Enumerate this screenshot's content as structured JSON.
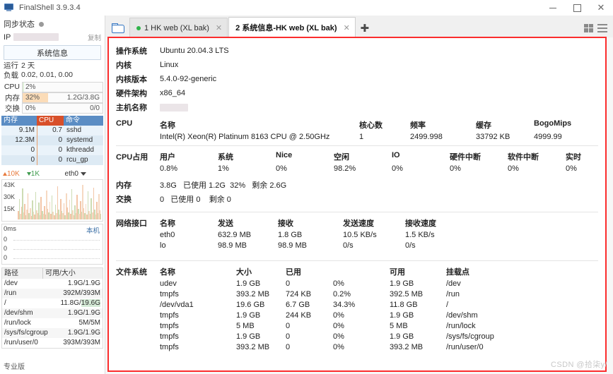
{
  "window": {
    "title": "FinalShell 3.9.3.4",
    "minimize": "—",
    "maximize": "□",
    "close": "✕"
  },
  "sidebar": {
    "sync_label": "同步状态",
    "ip_label": "IP",
    "copy_label": "复制",
    "sysinfo_button": "系统信息",
    "uptime_label": "运行",
    "uptime_value": "2 天",
    "load_label": "负载",
    "load_value": "0.02, 0.01, 0.00",
    "meters": [
      {
        "label": "CPU",
        "pct_text": "2%",
        "pct": 2,
        "right": "",
        "color": "#dff0d8"
      },
      {
        "label": "内存",
        "pct_text": "32%",
        "pct": 32,
        "right": "1.2G/3.8G",
        "color": "#fbdcb8"
      },
      {
        "label": "交换",
        "pct_text": "0%",
        "pct": 0,
        "right": "0/0",
        "color": "#e9e9e9"
      }
    ],
    "process_table": {
      "headers": [
        "内存",
        "CPU",
        "命令"
      ],
      "rows": [
        {
          "mem": "9.1M",
          "cpu": "0.7",
          "cmd": "sshd"
        },
        {
          "mem": "12.3M",
          "cpu": "0",
          "cmd": "systemd"
        },
        {
          "mem": "0",
          "cpu": "0",
          "cmd": "kthreadd"
        },
        {
          "mem": "0",
          "cpu": "0",
          "cmd": "rcu_gp"
        }
      ]
    },
    "network": {
      "up_value": "10K",
      "down_value": "1K",
      "interface": "eth0",
      "y_labels": [
        "43K",
        "30K",
        "15K"
      ]
    },
    "latency": {
      "unit_label": "0ms",
      "host_label": "本机",
      "rows": [
        "0",
        "0",
        "0"
      ]
    },
    "disk_table": {
      "headers": [
        "路径",
        "可用/大小"
      ],
      "rows": [
        {
          "path": "/dev",
          "value": "1.9G/1.9G",
          "hl": ""
        },
        {
          "path": "/run",
          "value": "392M/393M",
          "hl": ""
        },
        {
          "path": "/",
          "value": "11.8G/",
          "hl": "19.6G"
        },
        {
          "path": "/dev/shm",
          "value": "1.9G/1.9G",
          "hl": ""
        },
        {
          "path": "/run/lock",
          "value": "5M/5M",
          "hl": ""
        },
        {
          "path": "/sys/fs/cgroup",
          "value": "1.9G/1.9G",
          "hl": ""
        },
        {
          "path": "/run/user/0",
          "value": "393M/393M",
          "hl": ""
        }
      ]
    },
    "edition": "专业版"
  },
  "tabs": {
    "folder_icon": "open-folder-icon",
    "items": [
      {
        "label": "1 HK web  (XL bak)",
        "active": false,
        "dot": true
      },
      {
        "label": "2 系统信息-HK web  (XL bak)",
        "active": true,
        "dot": false
      }
    ],
    "close_glyph": "✕",
    "new_tab_glyph": "✚",
    "view_grid": "grid-view-icon",
    "view_list": "list-view-icon"
  },
  "sysinfo": {
    "basic": [
      {
        "key": "操作系统",
        "value": "Ubuntu 20.04.3 LTS",
        "masked": false
      },
      {
        "key": "内核",
        "value": "Linux",
        "masked": false
      },
      {
        "key": "内核版本",
        "value": "5.4.0-92-generic",
        "masked": false
      },
      {
        "key": "硬件架构",
        "value": "x86_64",
        "masked": false
      },
      {
        "key": "主机名称",
        "value": "",
        "masked": true
      }
    ],
    "cpu": {
      "lead": "CPU",
      "headers": [
        "名称",
        "核心数",
        "频率",
        "缓存",
        "BogoMips",
        ""
      ],
      "values": [
        "Intel(R) Xeon(R) Platinum 8163 CPU @ 2.50GHz",
        "1",
        "2499.998",
        "33792 KB",
        "4999.99",
        ""
      ]
    },
    "cpu_usage": {
      "lead": "CPU占用",
      "headers": [
        "用户",
        "系统",
        "Nice",
        "空闲",
        "IO",
        "硬件中断",
        "软件中断",
        "实时"
      ],
      "values": [
        "0.8%",
        "1%",
        "0%",
        "98.2%",
        "0%",
        "0%",
        "0%",
        "0%"
      ]
    },
    "memory": {
      "lead": "内存",
      "total": "3.8G",
      "used_label": "已使用",
      "used": "1.2G",
      "percent": "32%",
      "free_label": "剩余",
      "free": "2.6G"
    },
    "swap": {
      "lead": "交换",
      "total": "0",
      "used_label": "已使用",
      "used": "0",
      "free_label": "剩余",
      "free": "0"
    },
    "network": {
      "lead": "网络接口",
      "headers": [
        "名称",
        "发送",
        "接收",
        "发送速度",
        "接收速度"
      ],
      "rows": [
        {
          "name": "eth0",
          "tx": "632.9 MB",
          "rx": "1.8 GB",
          "tx_rate": "10.5 KB/s",
          "rx_rate": "1.5 KB/s"
        },
        {
          "name": "lo",
          "tx": "98.9 MB",
          "rx": "98.9 MB",
          "tx_rate": "0/s",
          "rx_rate": "0/s"
        }
      ]
    },
    "filesystem": {
      "lead": "文件系统",
      "headers": [
        "名称",
        "大小",
        "已用",
        "",
        "可用",
        "挂载点"
      ],
      "rows": [
        {
          "name": "udev",
          "size": "1.9 GB",
          "used": "0",
          "pct": "0%",
          "avail": "1.9 GB",
          "mount": "/dev"
        },
        {
          "name": "tmpfs",
          "size": "393.2 MB",
          "used": "724 KB",
          "pct": "0.2%",
          "avail": "392.5 MB",
          "mount": "/run"
        },
        {
          "name": "/dev/vda1",
          "size": "19.6 GB",
          "used": "6.7 GB",
          "pct": "34.3%",
          "avail": "11.8 GB",
          "mount": "/"
        },
        {
          "name": "tmpfs",
          "size": "1.9 GB",
          "used": "244 KB",
          "pct": "0%",
          "avail": "1.9 GB",
          "mount": "/dev/shm"
        },
        {
          "name": "tmpfs",
          "size": "5 MB",
          "used": "0",
          "pct": "0%",
          "avail": "5 MB",
          "mount": "/run/lock"
        },
        {
          "name": "tmpfs",
          "size": "1.9 GB",
          "used": "0",
          "pct": "0%",
          "avail": "1.9 GB",
          "mount": "/sys/fs/cgroup"
        },
        {
          "name": "tmpfs",
          "size": "393.2 MB",
          "used": "0",
          "pct": "0%",
          "avail": "393.2 MB",
          "mount": "/run/user/0"
        }
      ]
    }
  },
  "watermark": "CSDN @拾柒y/"
}
